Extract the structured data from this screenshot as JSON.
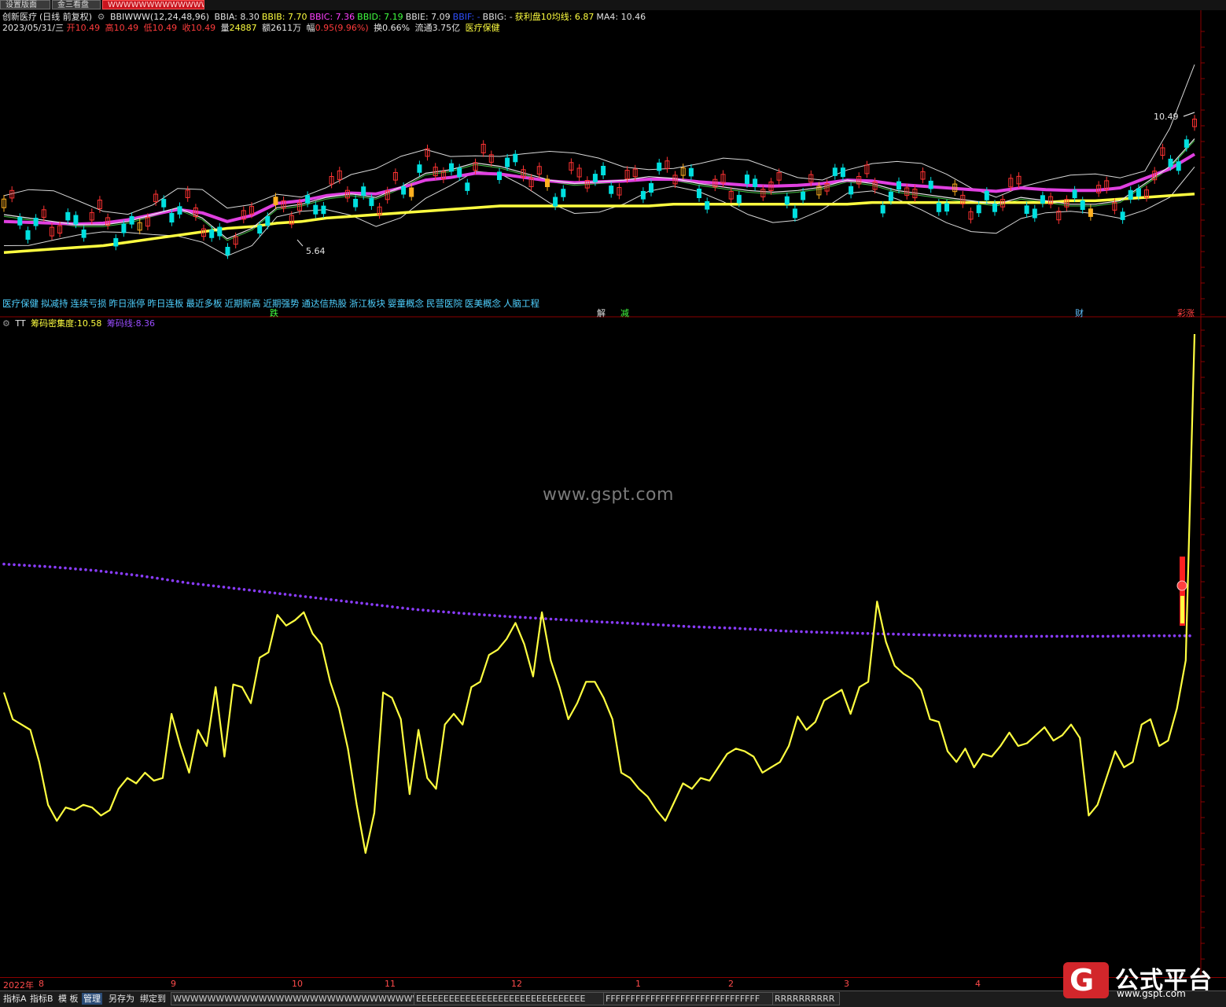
{
  "tabs": [
    "设置版面",
    "金三看盘",
    "WWWWWWWWWWWWWW"
  ],
  "main_header": {
    "title": "创新医疗",
    "period": "(日线 前复权)",
    "indicator": "BBIWWW(12,24,48,96)",
    "values": [
      {
        "label": "BBIA:",
        "value": "8.30",
        "color": "#e0e0e0"
      },
      {
        "label": "BBIB:",
        "value": "7.70",
        "color": "#ffff40"
      },
      {
        "label": "BBIC:",
        "value": "7.36",
        "color": "#ff40ff"
      },
      {
        "label": "BBID:",
        "value": "7.19",
        "color": "#40ff40"
      },
      {
        "label": "BBIE:",
        "value": "7.09",
        "color": "#e0e0e0"
      },
      {
        "label": "BBIF:",
        "value": "-",
        "color": "#3050ff"
      },
      {
        "label": "BBIG:",
        "value": "-",
        "color": "#e0e0e0"
      },
      {
        "label": "获利盘10均线:",
        "value": "6.87",
        "color": "#ffff40"
      },
      {
        "label": "MA4:",
        "value": "10.46",
        "color": "#e0e0e0"
      }
    ]
  },
  "quote": {
    "date": "2023/05/31/三",
    "open_label": "开",
    "open": "10.49",
    "high_label": "高",
    "high": "10.49",
    "low_label": "低",
    "low": "10.49",
    "close_label": "收",
    "close": "10.49",
    "volume_label": "量",
    "volume": "24887",
    "amount_label": "额",
    "amount": "2611万",
    "change_label": "幅",
    "change": "0.95(9.96%)",
    "turnover_label": "换",
    "turnover": "0.66%",
    "float_label": "流通",
    "float": "3.75亿",
    "sector": "医疗保健"
  },
  "price_marks": {
    "high": "10.49",
    "low": "5.64"
  },
  "concepts": [
    "医疗保健",
    "拟减持",
    "连续亏损",
    "昨日涨停",
    "昨日连板",
    "最近多板",
    "近期新高",
    "近期强势",
    "通达信热股",
    "浙江板块",
    "婴童概念",
    "民营医院",
    "医美概念",
    "人脑工程"
  ],
  "signals": [
    {
      "text": "跌",
      "color": "#40ff40"
    },
    {
      "text": "解",
      "color": "#e0e0e0"
    },
    {
      "text": "减",
      "color": "#40ff40"
    },
    {
      "text": "财",
      "color": "#60c0ff"
    },
    {
      "text": "彩涨",
      "color": "#ff4040"
    }
  ],
  "sub_header": {
    "name": "TT",
    "values": [
      {
        "label": "筹码密集度:",
        "value": "10.58",
        "color": "#ffff40"
      },
      {
        "label": "筹码线:",
        "value": "8.36",
        "color": "#9a4dff"
      }
    ]
  },
  "watermark": "www.gspt.com",
  "date_axis": [
    "2022年",
    "8",
    "9",
    "10",
    "11",
    "12",
    "1",
    "2",
    "3",
    "4"
  ],
  "toolbar": {
    "buttons": [
      "指标A",
      "指标B",
      "模 板",
      "管理",
      "另存为",
      "绑定到"
    ],
    "selected": "管理",
    "strips": [
      "WWWWWWWWWWWWWWWWWWWWWWWWWWWWWWW",
      "EEEEEEEEEEEEEEEEEEEEEEEEEEEEEEE",
      "FFFFFFFFFFFFFFFFFFFFFFFFFFFFFFF",
      "RRRRRRRRRR"
    ]
  },
  "logo": {
    "text": "公式平台",
    "url": "www.gspt.com"
  },
  "colors": {
    "up": "#ff3232",
    "down": "#00e0e0",
    "bbi": "#ffff40",
    "ma": "#e040e0",
    "density": "#ffff40",
    "chip_line": "#8a3cff"
  },
  "chart_data": [
    {
      "type": "line",
      "title": "筹码密集度",
      "series": [
        {
          "name": "筹码密集度",
          "values": [
            6.1,
            5.6,
            5.5,
            5.4,
            4.8,
            4.0,
            3.7,
            3.95,
            3.9,
            4.0,
            3.95,
            3.8,
            3.9,
            4.3,
            4.5,
            4.4,
            4.6,
            4.45,
            4.5,
            5.7,
            5.1,
            4.6,
            5.4,
            5.1,
            6.2,
            4.9,
            6.25,
            6.2,
            5.9,
            6.75,
            6.85,
            7.55,
            7.35,
            7.45,
            7.6,
            7.2,
            7.0,
            6.3,
            5.8,
            5.05,
            4.0,
            3.1,
            3.85,
            6.1,
            6.0,
            5.6,
            4.2,
            5.4,
            4.5,
            4.3,
            5.5,
            5.7,
            5.5,
            6.2,
            6.3,
            6.8,
            6.9,
            7.1,
            7.4,
            7.0,
            6.4,
            7.6,
            6.7,
            6.2,
            5.6,
            5.9,
            6.3,
            6.3,
            6.0,
            5.6,
            4.6,
            4.5,
            4.3,
            4.15,
            3.9,
            3.7,
            4.05,
            4.4,
            4.3,
            4.5,
            4.45,
            4.7,
            4.95,
            5.05,
            5.0,
            4.9,
            4.6,
            4.7,
            4.8,
            5.1,
            5.65,
            5.4,
            5.55,
            5.95,
            6.05,
            6.15,
            5.7,
            6.2,
            6.3,
            7.8,
            7.05,
            6.6,
            6.45,
            6.35,
            6.15,
            5.6,
            5.55,
            5.0,
            4.8,
            5.05,
            4.7,
            4.95,
            4.9,
            5.1,
            5.35,
            5.1,
            5.15,
            5.3,
            5.45,
            5.2,
            5.3,
            5.5,
            5.25,
            3.8,
            4.0,
            4.5,
            5.0,
            4.7,
            4.8,
            5.5,
            5.6,
            5.1,
            5.2,
            5.8,
            6.7,
            12.8
          ]
        },
        {
          "name": "筹码线",
          "values": [
            8.5,
            8.45,
            8.38,
            8.28,
            8.15,
            8.05,
            7.95,
            7.85,
            7.75,
            7.65,
            7.58,
            7.52,
            7.47,
            7.42,
            7.38,
            7.33,
            7.3,
            7.25,
            7.22,
            7.2,
            7.18,
            7.16,
            7.15,
            7.15,
            7.15,
            7.16,
            7.16
          ]
        }
      ]
    },
    {
      "type": "line",
      "title": "价格",
      "series": [
        {
          "name": "BBIA",
          "values": [
            6.1,
            6.0,
            5.9,
            5.8,
            5.8,
            5.9,
            6.1,
            6.3,
            6.0,
            5.4,
            5.7,
            6.3,
            6.4,
            6.6,
            6.7,
            6.6,
            6.9,
            7.3,
            7.4,
            7.6,
            7.5,
            7.3,
            7.1,
            7.0,
            7.05,
            7.1,
            7.2,
            7.15,
            7.0,
            6.9,
            6.8,
            6.75,
            6.8,
            6.9,
            7.1,
            7.0,
            6.8,
            6.7,
            6.6,
            6.5,
            6.4,
            6.6,
            6.5,
            6.4,
            6.4,
            6.5,
            7.0,
            7.5,
            8.3
          ]
        },
        {
          "name": "BBIB",
          "values": [
            5.0,
            5.05,
            5.1,
            5.15,
            5.2,
            5.3,
            5.4,
            5.5,
            5.6,
            5.7,
            5.75,
            5.85,
            5.9,
            6.0,
            6.05,
            6.1,
            6.15,
            6.2,
            6.25,
            6.3,
            6.35,
            6.35,
            6.35,
            6.35,
            6.35,
            6.35,
            6.35,
            6.4,
            6.4,
            6.4,
            6.4,
            6.4,
            6.4,
            6.4,
            6.4,
            6.45,
            6.45,
            6.45,
            6.45,
            6.45,
            6.45,
            6.45,
            6.45,
            6.5,
            6.5,
            6.55,
            6.6,
            6.65,
            6.7
          ]
        }
      ]
    }
  ]
}
